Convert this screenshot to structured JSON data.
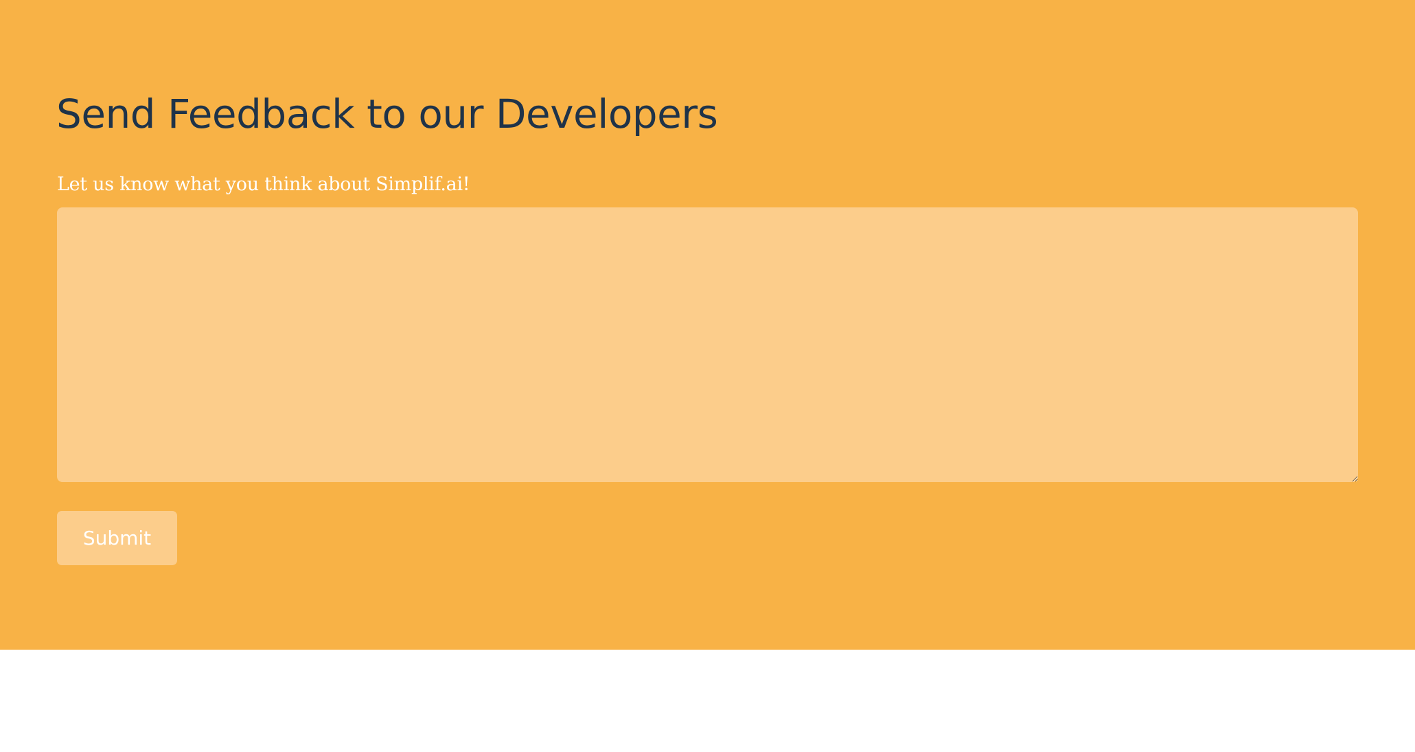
{
  "feedback": {
    "title": "Send Feedback to our Developers",
    "prompt_label": "Let us know what you think about Simplif.ai!",
    "textarea_value": "",
    "submit_label": "Submit"
  },
  "colors": {
    "section_background": "#f8b246",
    "field_background": "#fccd8b",
    "title_text": "#1f3349",
    "light_text": "#ffffff",
    "page_background": "#ffffff"
  }
}
